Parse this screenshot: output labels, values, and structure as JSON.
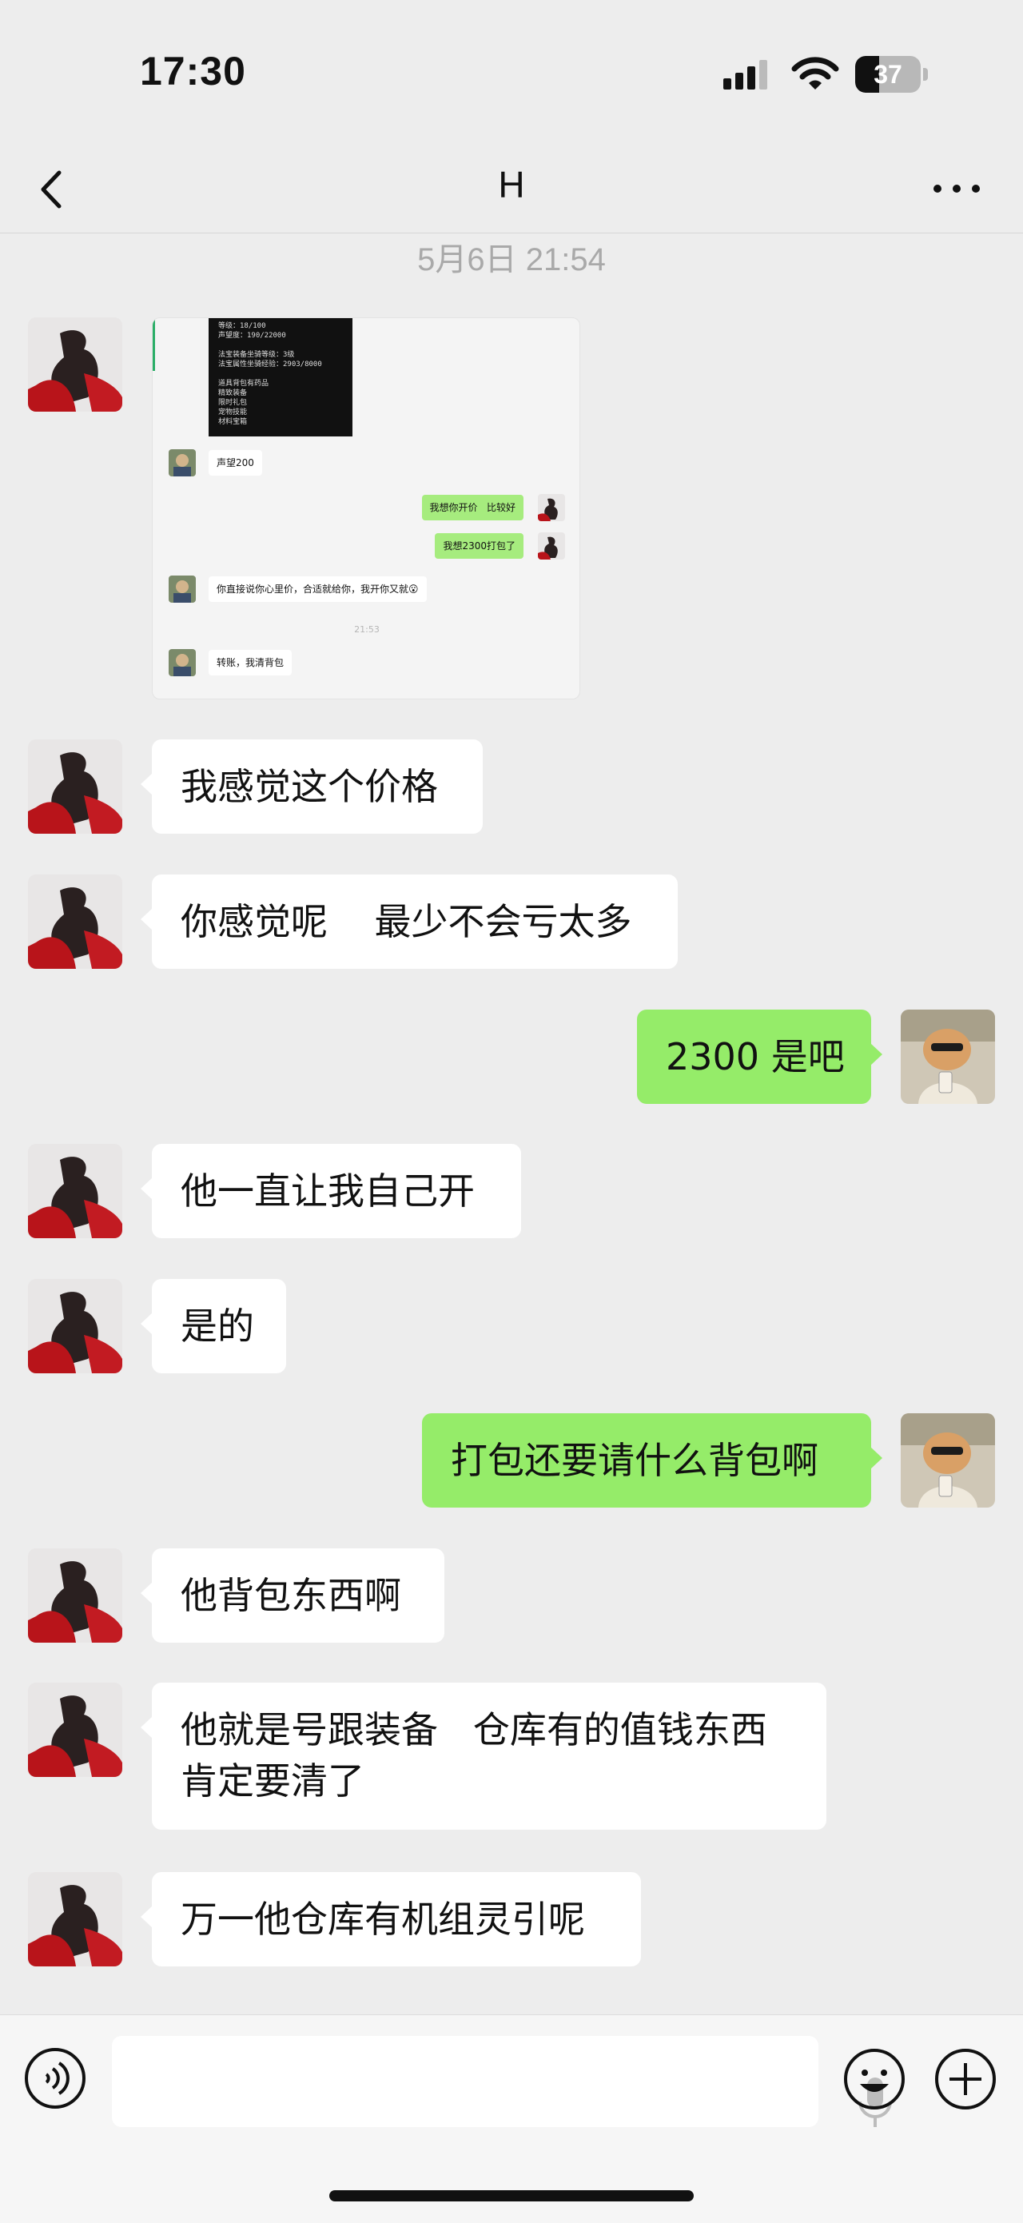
{
  "status_bar": {
    "time": "17:30",
    "battery": "37",
    "battery_level": 0.37
  },
  "nav": {
    "title": "H"
  },
  "timestamp": "5月6日 21:54",
  "embedded_screenshot": {
    "game_lines": [
      "等级：18/100",
      "声望度：190/22000",
      "",
      "法宝装备坐骑等级：3级",
      "法宝属性坐骑经验：2903/8000",
      "",
      "道具背包有药品",
      "精致装备",
      "限时礼包",
      "宠物技能",
      "材料宝箱"
    ],
    "messages": [
      {
        "side": "in",
        "text": "声望200"
      },
      {
        "side": "out",
        "text": "我想你开价   比较好"
      },
      {
        "side": "out",
        "text": "我想2300打包了"
      },
      {
        "side": "in",
        "text": "你直接说你心里价，合适就给你，我开你又就😮"
      },
      {
        "side": "in",
        "text": "转账，我清背包"
      }
    ],
    "time": "21:53"
  },
  "messages": [
    {
      "side": "in",
      "text": "我感觉这个价格"
    },
    {
      "side": "in",
      "text": "你感觉呢    最少不会亏太多"
    },
    {
      "side": "out",
      "text": "2300 是吧"
    },
    {
      "side": "in",
      "text": "他一直让我自己开"
    },
    {
      "side": "in",
      "text": "是的"
    },
    {
      "side": "out",
      "text": "打包还要请什么背包啊"
    },
    {
      "side": "in",
      "text": "他背包东西啊"
    },
    {
      "side": "in",
      "text": "他就是号跟装备   仓库有的值钱东西\n肯定要清了"
    },
    {
      "side": "in",
      "text": "万一他仓库有机组灵引呢"
    }
  ],
  "input": {
    "placeholder": ""
  },
  "colors": {
    "outgoing_bubble": "#95ec69",
    "incoming_bubble": "#ffffff",
    "background": "#ededed"
  }
}
